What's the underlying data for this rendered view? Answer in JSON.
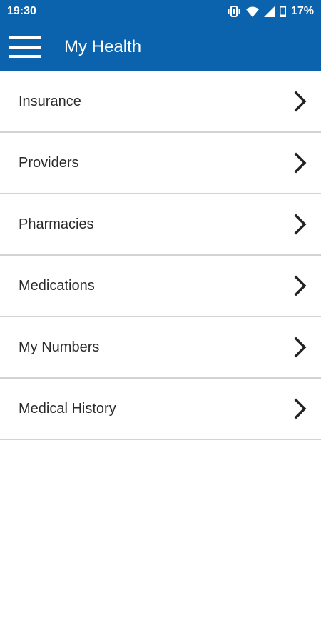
{
  "status_bar": {
    "time": "19:30",
    "battery_text": "17%",
    "icons": [
      "vibrate-icon",
      "wifi-icon",
      "cell-signal-icon",
      "battery-icon"
    ]
  },
  "app_bar": {
    "title": "My Health",
    "menu_icon": "hamburger-menu-icon"
  },
  "menu_items": [
    {
      "label": "Insurance"
    },
    {
      "label": "Providers"
    },
    {
      "label": "Pharmacies"
    },
    {
      "label": "Medications"
    },
    {
      "label": "My Numbers"
    },
    {
      "label": "Medical History"
    }
  ],
  "colors": {
    "primary": "#0b63ad",
    "divider": "#d3d3d3",
    "text": "#2a2a2a",
    "background": "#ffffff"
  }
}
